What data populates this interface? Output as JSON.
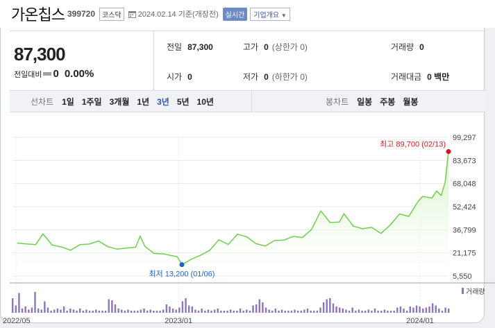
{
  "header": {
    "stock_name": "가온칩스",
    "stock_code": "399720",
    "market_tag": "코스닥",
    "date_text": "2024.02.14 기준(개장전)",
    "live_button": "실시간",
    "info_button": "기업개요"
  },
  "summary": {
    "current_price": "87,300",
    "change_label": "전일대비",
    "change_value": "0",
    "change_pct": "0.00%",
    "prev_close_label": "전일",
    "prev_close": "87,300",
    "high_label": "고가",
    "high": "0",
    "upper_limit": "(상한가 0)",
    "volume_label": "거래량",
    "volume": "0",
    "open_label": "시가",
    "open": "0",
    "low_label": "저가",
    "low": "0",
    "lower_limit": "(하한가 0)",
    "amount_label": "거래대금",
    "amount": "0 백만"
  },
  "periods": {
    "line_label": "선차트",
    "line_items": [
      "1일",
      "1주일",
      "3개월",
      "1년",
      "3년",
      "5년",
      "10년"
    ],
    "line_active": "3년",
    "candle_label": "봉차트",
    "candle_items": [
      "일봉",
      "주봉",
      "월봉"
    ]
  },
  "chart_data": {
    "type": "area",
    "x_tick_labels": [
      "2022/05",
      "2023/01",
      "2024/01"
    ],
    "y_tick_labels": [
      "99,297",
      "83,673",
      "68,048",
      "52,424",
      "36,799",
      "21,175",
      "5,550"
    ],
    "ylim": [
      5550,
      99297
    ],
    "grid": true,
    "high_annotation": "최고 89,700 (02/13)",
    "low_annotation": "최저 13,200 (01/06)",
    "volume_legend": "거래량",
    "colors": {
      "line": "#6fcf4d",
      "fill_top": "#cff4bd",
      "high": "#e0141e",
      "low": "#1f63c7",
      "volume": "#8e74b8"
    },
    "price_series": [
      {
        "x": "2022-05-02",
        "y": 27800
      },
      {
        "x": "2022-05-16",
        "y": 27200
      },
      {
        "x": "2022-05-30",
        "y": 26800
      },
      {
        "x": "2022-06-10",
        "y": 34000
      },
      {
        "x": "2022-06-24",
        "y": 26500
      },
      {
        "x": "2022-07-08",
        "y": 25200
      },
      {
        "x": "2022-07-22",
        "y": 23000
      },
      {
        "x": "2022-08-05",
        "y": 26800
      },
      {
        "x": "2022-08-19",
        "y": 27100
      },
      {
        "x": "2022-09-02",
        "y": 29200
      },
      {
        "x": "2022-09-16",
        "y": 25400
      },
      {
        "x": "2022-09-30",
        "y": 23700
      },
      {
        "x": "2022-10-14",
        "y": 24400
      },
      {
        "x": "2022-10-28",
        "y": 25000
      },
      {
        "x": "2022-11-04",
        "y": 32500
      },
      {
        "x": "2022-11-11",
        "y": 25600
      },
      {
        "x": "2022-11-25",
        "y": 20800
      },
      {
        "x": "2022-12-09",
        "y": 20500
      },
      {
        "x": "2022-12-23",
        "y": 19200
      },
      {
        "x": "2022-12-30",
        "y": 18600
      },
      {
        "x": "2023-01-06",
        "y": 13200
      },
      {
        "x": "2023-01-20",
        "y": 16800
      },
      {
        "x": "2023-02-03",
        "y": 19500
      },
      {
        "x": "2023-02-17",
        "y": 22900
      },
      {
        "x": "2023-03-03",
        "y": 30000
      },
      {
        "x": "2023-03-17",
        "y": 26900
      },
      {
        "x": "2023-03-31",
        "y": 33800
      },
      {
        "x": "2023-04-14",
        "y": 32100
      },
      {
        "x": "2023-04-28",
        "y": 27400
      },
      {
        "x": "2023-05-12",
        "y": 25800
      },
      {
        "x": "2023-05-26",
        "y": 29500
      },
      {
        "x": "2023-06-09",
        "y": 29800
      },
      {
        "x": "2023-06-23",
        "y": 32300
      },
      {
        "x": "2023-07-07",
        "y": 31500
      },
      {
        "x": "2023-07-21",
        "y": 37000
      },
      {
        "x": "2023-08-04",
        "y": 49500
      },
      {
        "x": "2023-08-18",
        "y": 41700
      },
      {
        "x": "2023-09-01",
        "y": 42000
      },
      {
        "x": "2023-09-08",
        "y": 47600
      },
      {
        "x": "2023-09-22",
        "y": 39300
      },
      {
        "x": "2023-10-06",
        "y": 37500
      },
      {
        "x": "2023-10-20",
        "y": 38400
      },
      {
        "x": "2023-11-03",
        "y": 34300
      },
      {
        "x": "2023-11-17",
        "y": 40000
      },
      {
        "x": "2023-12-01",
        "y": 47500
      },
      {
        "x": "2023-12-15",
        "y": 45800
      },
      {
        "x": "2023-12-29",
        "y": 56000
      },
      {
        "x": "2024-01-05",
        "y": 59300
      },
      {
        "x": "2024-01-19",
        "y": 58300
      },
      {
        "x": "2024-01-26",
        "y": 63000
      },
      {
        "x": "2024-02-02",
        "y": 60000
      },
      {
        "x": "2024-02-08",
        "y": 69000
      },
      {
        "x": "2024-02-13",
        "y": 89700
      }
    ],
    "volume_relative": [
      0.7,
      0.35,
      0.95,
      0.2,
      0.3,
      0.15,
      0.25,
      1.0,
      0.2,
      0.15,
      0.55,
      0.25,
      0.1,
      0.15,
      0.2,
      0.15,
      0.3,
      0.1,
      0.2,
      0.15,
      0.1,
      0.2,
      0.1,
      0.15,
      0.1,
      0.1,
      0.15,
      0.1,
      0.1,
      0.1,
      0.65,
      0.6,
      0.4,
      0.2,
      0.15,
      0.1,
      0.15,
      0.1,
      0.1,
      0.1,
      0.15,
      0.2,
      0.1,
      0.15,
      0.1,
      0.1,
      0.1,
      0.15,
      0.4,
      0.3,
      0.2,
      0.15,
      0.25,
      0.55,
      0.7,
      0.35,
      0.3,
      0.15,
      0.1,
      0.2,
      0.1,
      0.15,
      0.1,
      0.15,
      0.2,
      0.1,
      0.1,
      0.1,
      0.15,
      0.1,
      0.1,
      0.2,
      0.1,
      0.15,
      0.1,
      0.35,
      0.4,
      0.65,
      0.5,
      0.25,
      0.15,
      0.1,
      0.2,
      0.1,
      0.15,
      0.1,
      0.1,
      0.1,
      0.15,
      0.1,
      0.1,
      0.15,
      0.2,
      0.1,
      0.1,
      0.1,
      0.25,
      0.5,
      0.65,
      0.7,
      0.45,
      0.3,
      0.25,
      0.2,
      0.15,
      0.1,
      0.25,
      0.1,
      0.15,
      0.1,
      0.1,
      0.15,
      0.1,
      0.2,
      0.1,
      0.1,
      0.15,
      0.1,
      0.1,
      0.1,
      0.25,
      0.3,
      0.2,
      0.1,
      0.3,
      0.25,
      0.35,
      0.3,
      0.2,
      0.25,
      0.3,
      0.45,
      0.35,
      0.2,
      0.1,
      0.25,
      0.2
    ]
  }
}
